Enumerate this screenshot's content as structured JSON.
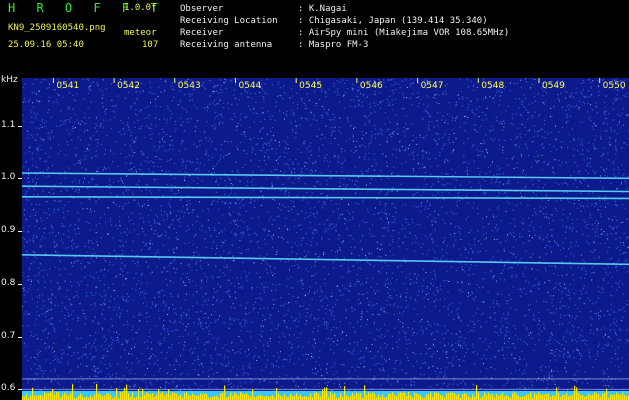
{
  "header": {
    "title": "H R O F F T",
    "version": "1.0.0f",
    "filename": "KN9_2509160540.png",
    "mode": "meteor",
    "datetime": "25.09.16 05:40",
    "count": "107",
    "observer_label": "Observer",
    "observer_value": ": K.Nagai",
    "location_label": "Receiving Location",
    "location_value": ": Chigasaki, Japan (139.414 35.340)",
    "receiver_label": "Receiver",
    "receiver_value": ": AirSpy mini (Miakejima VOR 108.65MHz)",
    "antenna_label": "Receiving antenna",
    "antenna_value": ": Maspro FM-3"
  },
  "chart_data": {
    "type": "heatmap",
    "ylabel": "kHz",
    "y_ticks": [
      "1.1",
      "1.0",
      "0.9",
      "0.8",
      "0.7",
      "0.6"
    ],
    "y_values": [
      1.1,
      1.0,
      0.9,
      0.8,
      0.7,
      0.6
    ],
    "ylim": [
      0.58,
      1.19
    ],
    "x_ticks": [
      "0541",
      "0542",
      "0543",
      "0544",
      "0545",
      "0546",
      "0547",
      "0548",
      "0549",
      "0550"
    ],
    "xlim": [
      "0540",
      "0550"
    ],
    "traces": [
      {
        "y_start": 1.01,
        "y_end": 1.0
      },
      {
        "y_start": 0.985,
        "y_end": 0.975
      },
      {
        "y_start": 0.965,
        "y_end": 0.962
      },
      {
        "y_start": 0.855,
        "y_end": 0.837
      },
      {
        "y_start": 0.62,
        "y_end": 0.62
      },
      {
        "y_start": 0.6,
        "y_end": 0.6
      }
    ],
    "colors": {
      "background": "#0d1a8c",
      "noise": "#3a6cf0",
      "trace": "#5fe8ff",
      "baseline": "#38c8ff",
      "baseline_peak": "#ffe800"
    }
  }
}
